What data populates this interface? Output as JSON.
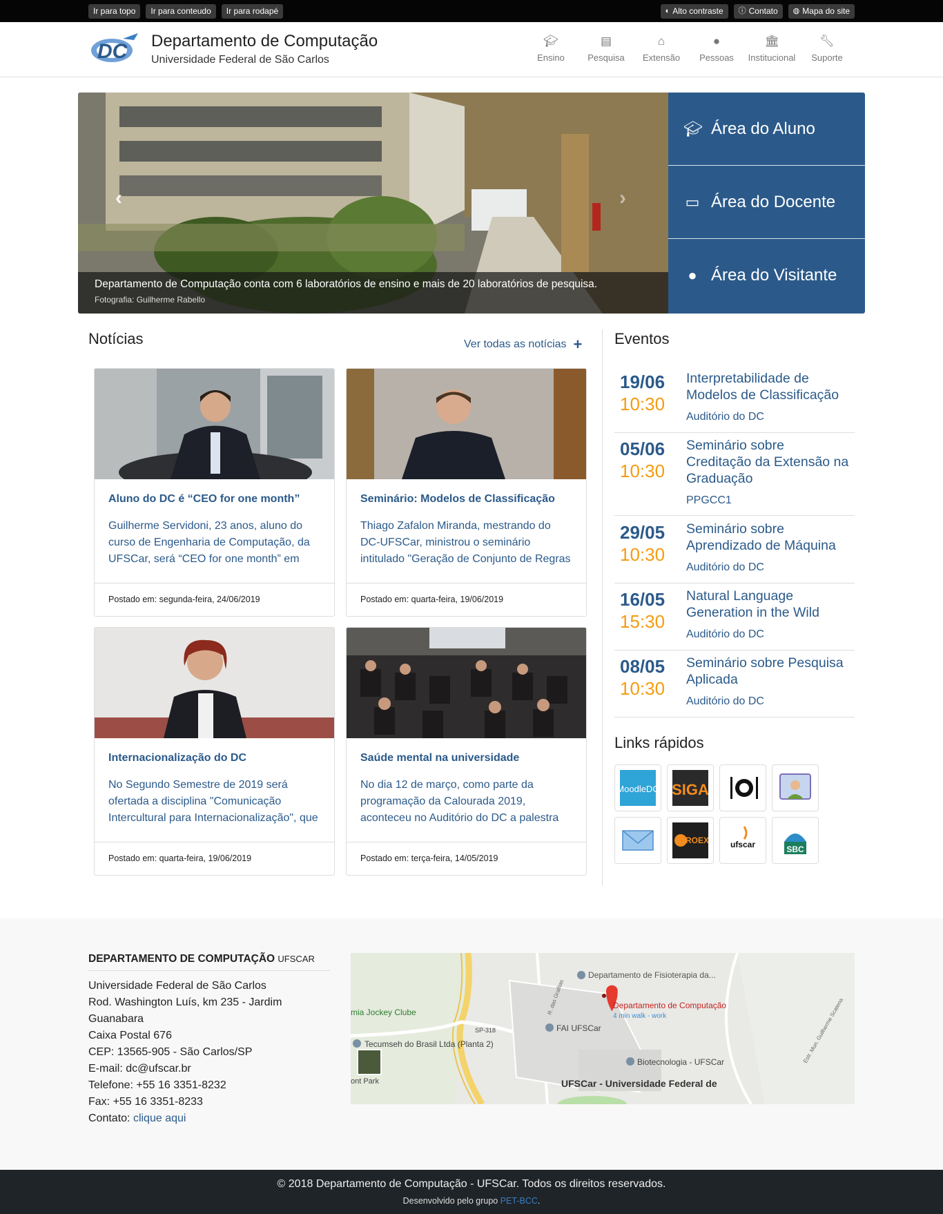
{
  "access_bar": {
    "left": [
      "Ir para topo",
      "Ir para conteudo",
      "Ir para rodapé"
    ],
    "right": [
      {
        "icon": "contrast-icon",
        "label": "Alto contraste"
      },
      {
        "icon": "info-icon",
        "label": "Contato"
      },
      {
        "icon": "globe-icon",
        "label": "Mapa do site"
      }
    ]
  },
  "header": {
    "title": "Departamento de Computação",
    "subtitle": "Universidade Federal de São Carlos",
    "nav": [
      {
        "icon": "graduation-cap-icon",
        "label": "Ensino"
      },
      {
        "icon": "book-icon",
        "label": "Pesquisa"
      },
      {
        "icon": "home-icon",
        "label": "Extensão"
      },
      {
        "icon": "user-icon",
        "label": "Pessoas"
      },
      {
        "icon": "university-icon",
        "label": "Institucional"
      },
      {
        "icon": "wrench-icon",
        "label": "Suporte"
      }
    ]
  },
  "hero": {
    "caption": "Departamento de Computação conta com 6 laboratórios de ensino e mais de 20 laboratórios de pesquisa.",
    "credit": "Fotografia: Guilherme Rabello",
    "areas": [
      {
        "icon": "student-icon",
        "label": "Área do Aluno"
      },
      {
        "icon": "teacher-icon",
        "label": "Área do Docente"
      },
      {
        "icon": "visitor-icon",
        "label": "Área do Visitante"
      }
    ]
  },
  "news": {
    "title": "Notícias",
    "see_all": "Ver todas as notícias",
    "items": [
      {
        "title": "Aluno do DC é “CEO for one month”",
        "text": "Guilherme Servidoni, 23 anos, aluno do curso de Engenharia de Computação, da UFSCar, será “CEO for one month” em",
        "posted": "Postado em: segunda-feira, 24/06/2019"
      },
      {
        "title": "Seminário: Modelos de Classificação",
        "text": "Thiago Zafalon Miranda, mestrando do DC-UFSCar, ministrou o seminário intitulado \"Geração de Conjunto de Regras",
        "posted": "Postado em: quarta-feira, 19/06/2019"
      },
      {
        "title": "Internacionalização do DC",
        "text": "No Segundo Semestre de 2019 será ofertada a disciplina \"Comunicação Intercultural para Internacionalização\", que",
        "posted": "Postado em: quarta-feira, 19/06/2019"
      },
      {
        "title": "Saúde mental na universidade",
        "text": "No dia 12 de março, como parte da programação da Calourada 2019, aconteceu no Auditório do DC a palestra",
        "posted": "Postado em: terça-feira, 14/05/2019"
      }
    ]
  },
  "events": {
    "title": "Eventos",
    "items": [
      {
        "date": "19/06",
        "time": "10:30",
        "title": "Interpretabilidade de Modelos de Classificação",
        "place": "Auditório do DC"
      },
      {
        "date": "05/06",
        "time": "10:30",
        "title": "Seminário sobre Creditação da Extensão na Graduação",
        "place": "PPGCC1"
      },
      {
        "date": "29/05",
        "time": "10:30",
        "title": "Seminário sobre Aprendizado de Máquina",
        "place": "Auditório do DC"
      },
      {
        "date": "16/05",
        "time": "15:30",
        "title": "Natural Language Generation in the Wild",
        "place": "Auditório do DC"
      },
      {
        "date": "08/05",
        "time": "10:30",
        "title": "Seminário sobre Pesquisa Aplicada",
        "place": "Auditório do DC"
      }
    ]
  },
  "quick_links": {
    "title": "Links rápidos",
    "items": [
      {
        "label": "MoodleDC",
        "icon": "moodle-icon"
      },
      {
        "label": "SIGA",
        "icon": "siga-icon"
      },
      {
        "label": "",
        "icon": "restaurant-icon"
      },
      {
        "label": "",
        "icon": "videoconference-icon"
      },
      {
        "label": "",
        "icon": "email-icon"
      },
      {
        "label": "PROEX",
        "icon": "proex-icon"
      },
      {
        "label": "ufscar",
        "icon": "ufscar-icon"
      },
      {
        "label": "SBC",
        "icon": "sbc-icon"
      }
    ]
  },
  "footer": {
    "title": "DEPARTAMENTO DE COMPUTAÇÃO",
    "title_suffix": "UFSCAR",
    "lines": [
      "Universidade Federal de São Carlos",
      "Rod. Washington Luís, km 235 - Jardim Guanabara",
      "Caixa Postal 676",
      "CEP: 13565-905 - São Carlos/SP",
      "E-mail: dc@ufscar.br",
      "Telefone: +55 16 3351-8232",
      "Fax: +55 16 3351-8233"
    ],
    "contact_label": "Contato: ",
    "contact_link": "clique aqui",
    "map": {
      "labels": [
        "Departamento de Fisioterapia da...",
        "Departamento de Computação",
        "4 min walk - work",
        "FAI UFSCar",
        "Tecumseh do Brasil Ltda (Planta 2)",
        "Biotecnologia - UFSCar",
        "UFSCar - Universidade Federal de",
        "mia Jockey Clube",
        "SP-318",
        "ont Park",
        "R. das Grafitas",
        "Estr. Mun. Guilherme Scatena"
      ]
    },
    "copyright": "© 2018 Departamento de Computação - UFSCar. Todos os direitos reservados.",
    "dev_prefix": "Desenvolvido pelo grupo ",
    "dev_link": "PET-BCC",
    "dev_suffix": "."
  },
  "colors": {
    "primary": "#2b5a8a",
    "accent": "#f39c12",
    "dark": "#1f2428"
  }
}
